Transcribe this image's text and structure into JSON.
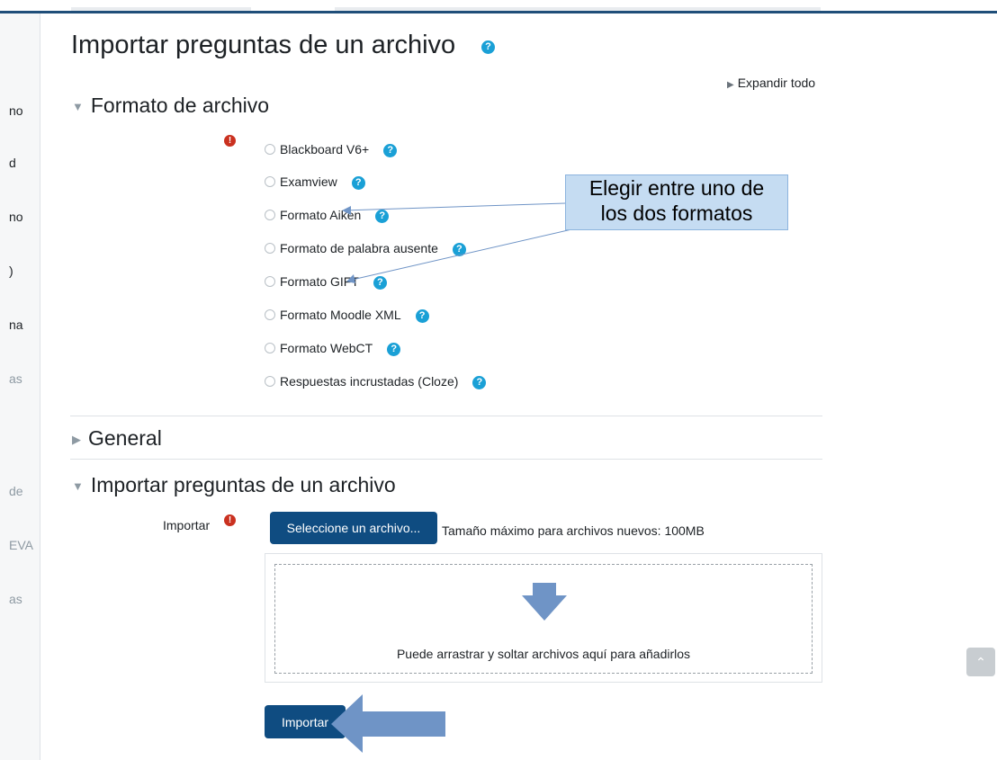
{
  "sidebar": {
    "items": [
      {
        "label": "no",
        "muted": false
      },
      {
        "label": "d",
        "muted": false
      },
      {
        "label": "no",
        "muted": false
      },
      {
        "label": ")",
        "muted": false
      },
      {
        "label": "na",
        "muted": false
      },
      {
        "label": "as",
        "muted": true
      },
      {
        "label": "de",
        "muted": true
      },
      {
        "label": "EVA",
        "muted": true
      },
      {
        "label": "as",
        "muted": true
      }
    ]
  },
  "page": {
    "title": "Importar preguntas de un archivo",
    "help_glyph": "?",
    "expand_all": "Expandir todo"
  },
  "sections": {
    "format": {
      "label": "Formato de archivo",
      "expanded": true,
      "options": [
        {
          "label": "Blackboard V6+",
          "icon": "help-icon"
        },
        {
          "label": "Examview",
          "icon": "help-icon"
        },
        {
          "label": "Formato Aiken",
          "icon": "help-icon"
        },
        {
          "label": "Formato de palabra ausente",
          "icon": "help-icon"
        },
        {
          "label": "Formato GIFT",
          "icon": "help-icon"
        },
        {
          "label": "Formato Moodle XML",
          "icon": "help-icon"
        },
        {
          "label": "Formato WebCT",
          "icon": "help-icon"
        },
        {
          "label": "Respuestas incrustadas (Cloze)",
          "icon": "help-icon"
        }
      ]
    },
    "general": {
      "label": "General",
      "expanded": false
    },
    "import_file": {
      "label": "Importar preguntas de un archivo",
      "expanded": true,
      "field_label": "Importar",
      "choose_button": "Seleccione un archivo...",
      "max_size": "Tamaño máximo para archivos nuevos: 100MB",
      "dropzone_text": "Puede arrastrar y soltar archivos aquí para añadirlos"
    }
  },
  "submit_button": "Importar",
  "annotation": {
    "text_line1": "Elegir entre uno de",
    "text_line2": "los dos formatos"
  },
  "colors": {
    "primary": "#0f4c81",
    "help": "#1aa0d6",
    "required": "#ca3120",
    "annotation_fill": "#c5dcf2",
    "arrow_fill": "#6f94c6"
  }
}
